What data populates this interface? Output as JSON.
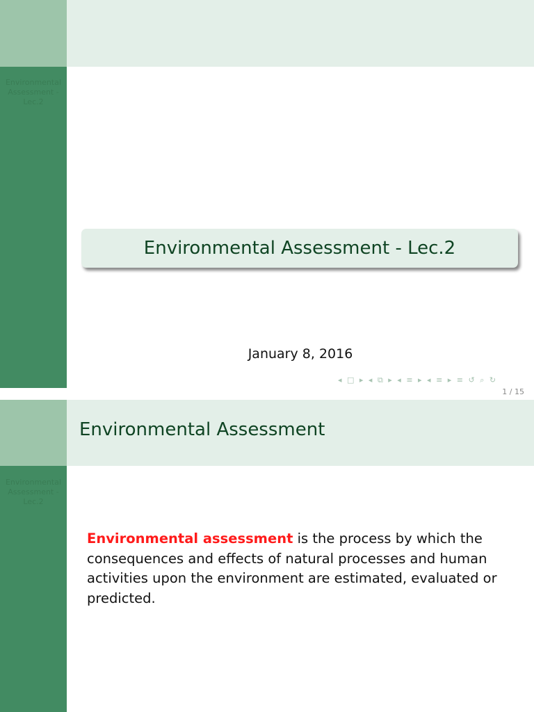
{
  "slide1": {
    "sidebar_title": "Environmental Assessment - Lec.2",
    "title": "Environmental Assessment - Lec.2",
    "date": "January 8, 2016",
    "nav_symbols": "◂ □ ▸ ◂ ⧉ ▸ ◂ ≡ ▸ ◂ ≡ ▸   ≡   ↺ ⌕ ↻",
    "page": "1 / 15"
  },
  "slide2": {
    "sidebar_title": "Environmental Assessment - Lec.2",
    "frame_title": "Environmental Assessment",
    "term": "Environmental assessment",
    "body": " is the process by which the consequences and effects of natural processes and human activities upon the environment are estimated, evaluated or predicted."
  },
  "colors": {
    "sidebar": "#428b62",
    "header": "#e3efe8",
    "alert": "#ff1a1a"
  }
}
